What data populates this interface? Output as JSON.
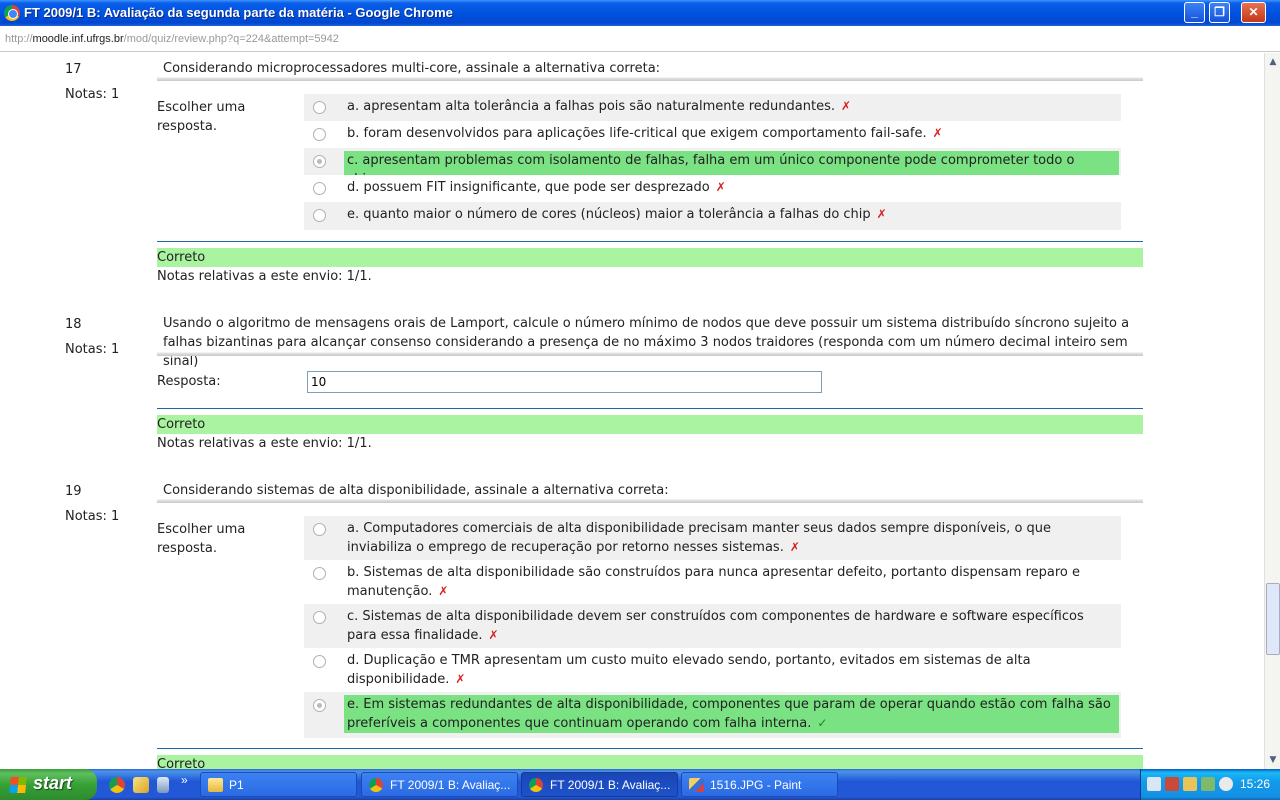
{
  "window": {
    "title": "FT 2009/1 B: Avaliação da segunda parte da matéria - Google Chrome",
    "url_prefix": "http://",
    "url_host": "moodle.inf.ufrgs.br",
    "url_path": "/mod/quiz/review.php?q=224&attempt=5942"
  },
  "questions": [
    {
      "number": "17",
      "grade": "Notas: 1",
      "text": "Considerando microprocessadores multi-core, assinale a alternativa correta:",
      "prompt": "Escolher uma resposta.",
      "answers": [
        {
          "label": "a. apresentam alta tolerância a falhas pois são naturalmente redundantes.",
          "mark": "✗",
          "selected": false,
          "correct": false
        },
        {
          "label": "b. foram desenvolvidos para aplicações life-critical que exigem comportamento fail-safe.",
          "mark": "✗",
          "selected": false,
          "correct": false
        },
        {
          "label": "c. apresentam problemas com isolamento de falhas, falha em um único componente pode comprometer todo o chip",
          "mark": "✓",
          "selected": true,
          "correct": true
        },
        {
          "label": "d. possuem FIT insignificante, que pode ser desprezado",
          "mark": "✗",
          "selected": false,
          "correct": false
        },
        {
          "label": "e. quanto maior o número de cores (núcleos) maior a tolerância a falhas do chip",
          "mark": "✗",
          "selected": false,
          "correct": false
        }
      ],
      "feedback": "Correto",
      "grade_line": "Notas relativas a este envio: 1/1."
    },
    {
      "number": "18",
      "grade": "Notas: 1",
      "text": "Usando o algoritmo de mensagens orais de Lamport, calcule o número mínimo de nodos que deve possuir um sistema distribuído síncrono sujeito a falhas bizantinas para alcançar consenso considerando a presença de no máximo 3 nodos traidores (responda com um número decimal inteiro sem sinal)",
      "prompt": "Resposta:",
      "answer_value": "10",
      "feedback": "Correto",
      "grade_line": "Notas relativas a este envio: 1/1."
    },
    {
      "number": "19",
      "grade": "Notas: 1",
      "text": "Considerando sistemas de alta disponibilidade, assinale a alternativa correta:",
      "prompt": "Escolher uma resposta.",
      "answers": [
        {
          "label": "a. Computadores comerciais de alta disponibilidade precisam manter seus dados sempre disponíveis, o que inviabiliza o emprego de recuperação por retorno nesses sistemas.",
          "mark": "✗",
          "selected": false,
          "correct": false
        },
        {
          "label": "b. Sistemas de alta disponibilidade são construídos para nunca apresentar defeito, portanto dispensam reparo e manutenção.",
          "mark": "✗",
          "selected": false,
          "correct": false
        },
        {
          "label": "c. Sistemas de alta disponibilidade devem ser construídos com componentes de hardware e software específicos para essa finalidade.",
          "mark": "✗",
          "selected": false,
          "correct": false
        },
        {
          "label": "d. Duplicação e TMR apresentam um custo muito elevado sendo, portanto, evitados em sistemas de alta disponibilidade.",
          "mark": "✗",
          "selected": false,
          "correct": false
        },
        {
          "label": "e. Em sistemas redundantes de alta disponibilidade, componentes que param de operar quando estão com falha são preferíveis a componentes que continuam operando com falha interna.",
          "mark": "✓",
          "selected": true,
          "correct": true
        }
      ],
      "feedback": "Correto"
    }
  ],
  "taskbar": {
    "start_label": "start",
    "more_label": "»",
    "tasks": [
      {
        "label": "P1",
        "icon": "folder-icon",
        "active": false
      },
      {
        "label": "FT 2009/1 B: Avaliaç...",
        "icon": "chrome-icon",
        "active": false
      },
      {
        "label": "FT 2009/1 B: Avaliaç...",
        "icon": "chrome-icon",
        "active": true
      },
      {
        "label": "1516.JPG - Paint",
        "icon": "paint-icon",
        "active": false
      }
    ],
    "clock": "15:26"
  },
  "colors": {
    "correct_answer_bg": "#7ae283",
    "feedback_bg": "#aaf3a0",
    "wrong_mark": "#d62020",
    "right_mark": "#148a14"
  }
}
